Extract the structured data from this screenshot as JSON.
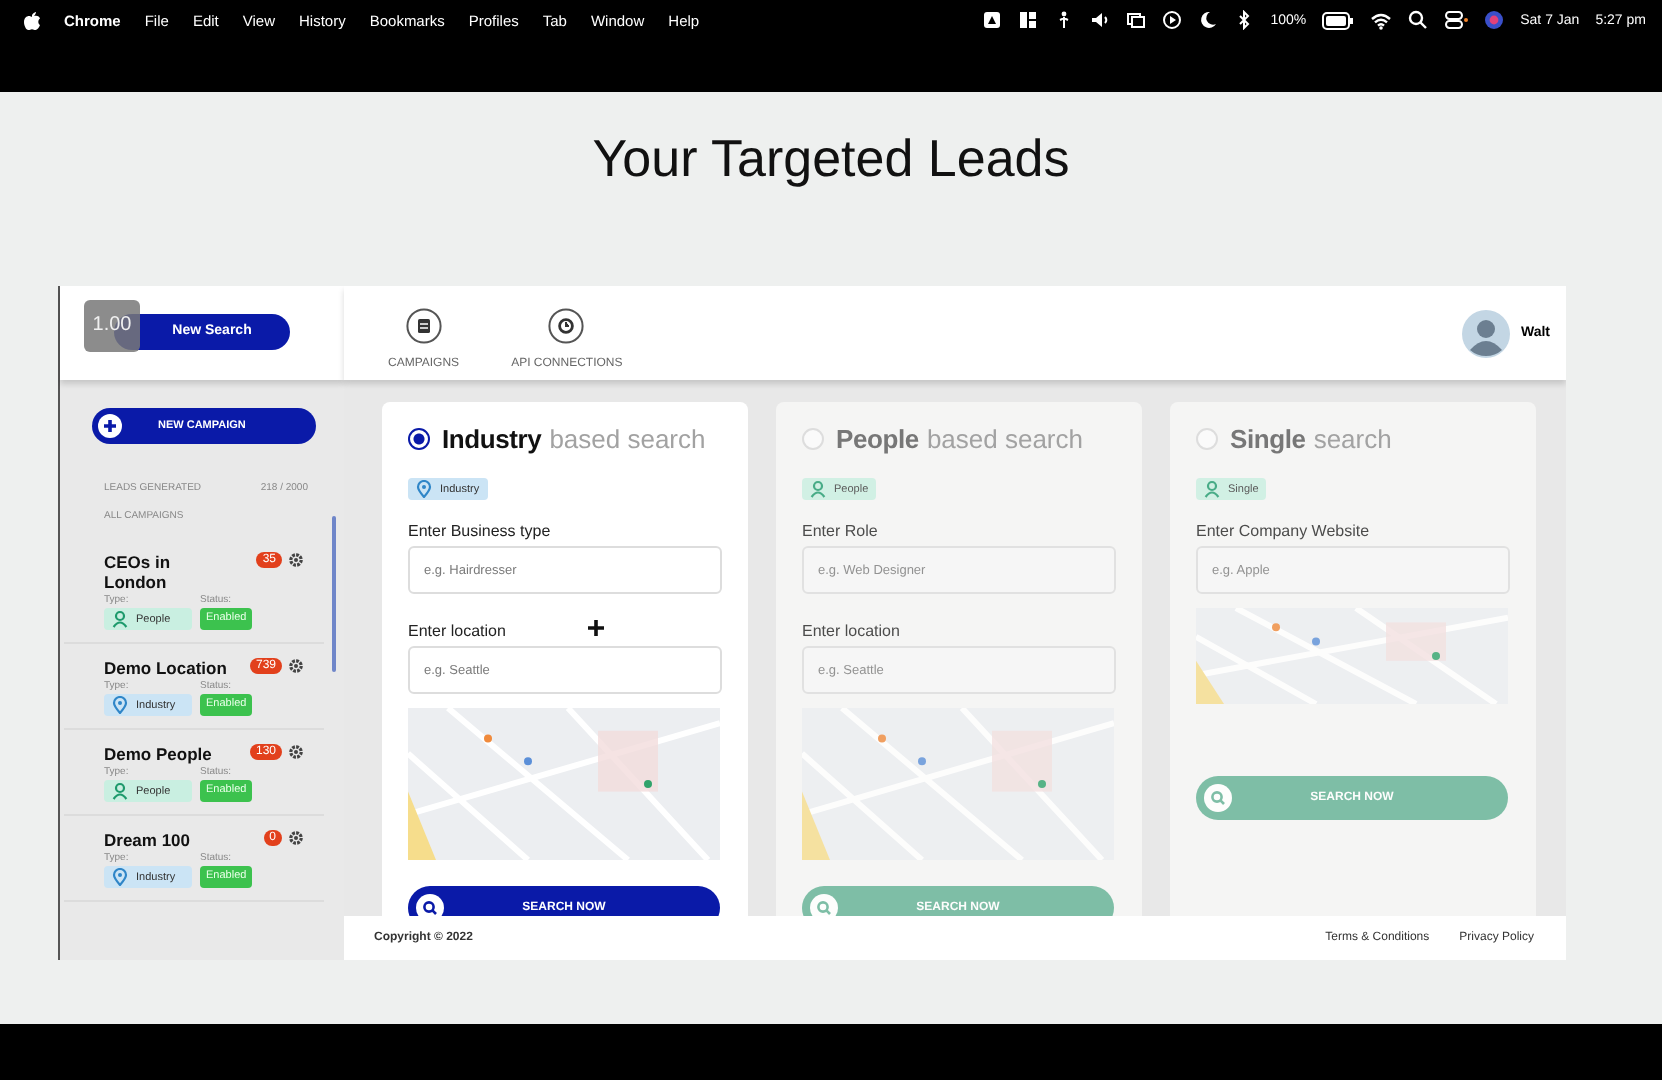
{
  "menubar": {
    "app": "Chrome",
    "menus": [
      "File",
      "Edit",
      "View",
      "History",
      "Bookmarks",
      "Profiles",
      "Tab",
      "Window",
      "Help"
    ],
    "battery": "100%",
    "date": "Sat 7 Jan",
    "time": "5:27 pm"
  },
  "slide": {
    "title": "Your Targeted Leads"
  },
  "sidebar": {
    "zoom_overlay": "1.00",
    "new_search": "New Search",
    "new_campaign": "NEW CAMPAIGN",
    "leads_label": "LEADS GENERATED",
    "leads_value": "218 / 2000",
    "section": "ALL CAMPAIGNS",
    "campaigns": [
      {
        "name": "CEOs in London",
        "count": "35",
        "type_label": "Type:",
        "status_label": "Status:",
        "type": {
          "kind": "people",
          "label": "People"
        },
        "status": "Enabled"
      },
      {
        "name": "Demo Location",
        "count": "739",
        "type_label": "Type:",
        "status_label": "Status:",
        "type": {
          "kind": "industry",
          "label": "Industry"
        },
        "status": "Enabled"
      },
      {
        "name": "Demo People",
        "count": "130",
        "type_label": "Type:",
        "status_label": "Status:",
        "type": {
          "kind": "people",
          "label": "People"
        },
        "status": "Enabled"
      },
      {
        "name": "Dream 100",
        "count": "0",
        "type_label": "Type:",
        "status_label": "Status:",
        "type": {
          "kind": "industry",
          "label": "Industry"
        },
        "status": "Enabled"
      }
    ]
  },
  "header": {
    "tabs": [
      {
        "label": "CAMPAIGNS",
        "kind": "campaigns"
      },
      {
        "label": "API CONNECTIONS",
        "kind": "api"
      }
    ],
    "user": "Walt"
  },
  "cards": [
    {
      "selected": true,
      "title": "Industry",
      "subtitle": "based search",
      "tag": {
        "kind": "industry",
        "label": "Industry"
      },
      "fields": [
        {
          "label": "Enter Business type",
          "placeholder": "e.g. Hairdresser"
        },
        {
          "label": "Enter location",
          "placeholder": "e.g. Seattle"
        }
      ],
      "button": "SEARCH NOW"
    },
    {
      "selected": false,
      "title": "People",
      "subtitle": "based search",
      "tag": {
        "kind": "people",
        "label": "People"
      },
      "fields": [
        {
          "label": "Enter Role",
          "placeholder": "e.g. Web Designer"
        },
        {
          "label": "Enter location",
          "placeholder": "e.g. Seattle"
        }
      ],
      "button": "SEARCH NOW"
    },
    {
      "selected": false,
      "title": "Single",
      "subtitle": "search",
      "tag": {
        "kind": "people",
        "label": "Single"
      },
      "fields": [
        {
          "label": "Enter Company Website",
          "placeholder": "e.g. Apple"
        }
      ],
      "button": "SEARCH NOW"
    }
  ],
  "footer": {
    "copyright": "Copyright © 2022",
    "links": [
      "Terms & Conditions",
      "Privacy Policy"
    ]
  }
}
